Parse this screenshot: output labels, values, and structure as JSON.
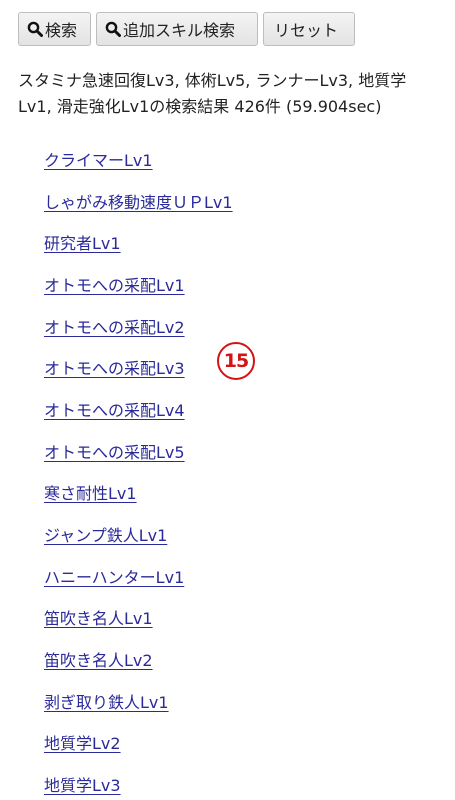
{
  "toolbar": {
    "search_label": "検索",
    "skill_search_label": "追加スキル検索",
    "reset_label": "リセット",
    "search_icon": "magnifier-icon"
  },
  "summary": {
    "text": "スタミナ急速回復Lv3, 体術Lv5, ランナーLv3, 地質学Lv1, 滑走強化Lv1の検索結果 426件 (59.904sec)"
  },
  "results": [
    "クライマーLv1",
    "しゃがみ移動速度ＵＰLv1",
    "研究者Lv1",
    "オトモへの采配Lv1",
    "オトモへの采配Lv2",
    "オトモへの采配Lv3",
    "オトモへの采配Lv4",
    "オトモへの采配Lv5",
    "寒さ耐性Lv1",
    "ジャンプ鉄人Lv1",
    "ハニーハンターLv1",
    "笛吹き名人Lv1",
    "笛吹き名人Lv2",
    "剥ぎ取り鉄人Lv1",
    "地質学Lv2",
    "地質学Lv3"
  ],
  "annotation": {
    "label": "15",
    "color": "#d41414"
  },
  "colors": {
    "link": "#2a2a9a",
    "text": "#222222",
    "button_border": "#bdbdbd"
  }
}
